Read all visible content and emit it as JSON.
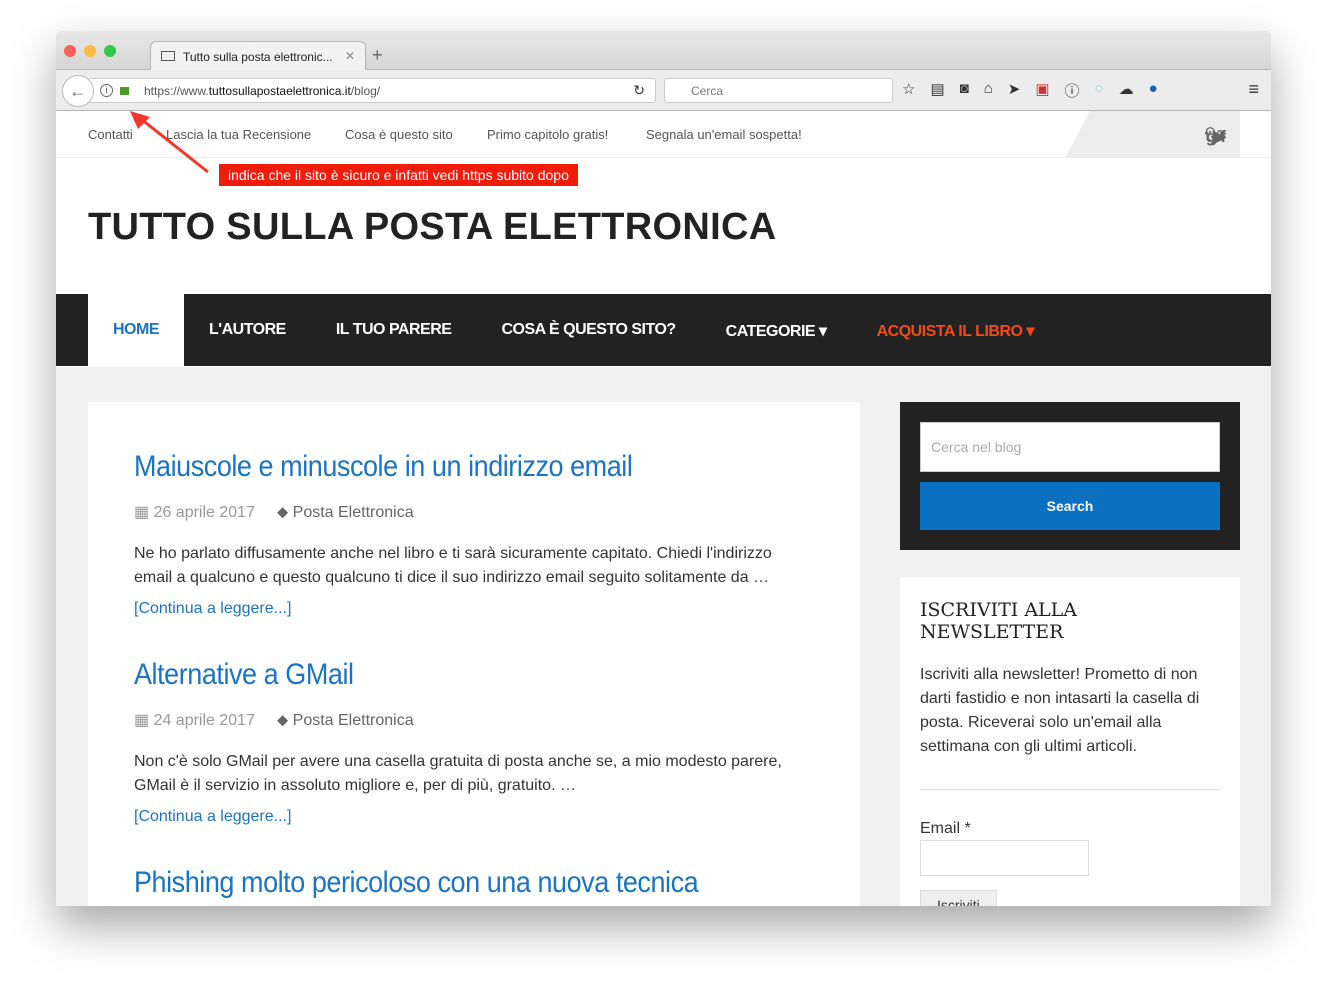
{
  "browser": {
    "tab_title": "Tutto sulla posta elettronic...",
    "url_prefix": "https://www.",
    "url_domain": "tuttosullapostaelettronica.it",
    "url_path": "/blog/",
    "search_placeholder": "Cerca"
  },
  "annotation": "indica che il sito è sicuro e infatti vedi https subito dopo",
  "topnav": [
    "Contatti",
    "Lascia la tua Recensione",
    "Cosa è questo sito",
    "Primo capitolo gratis!",
    "Segnala un'email sospetta!"
  ],
  "social": [
    "facebook",
    "twitter",
    "google-plus",
    "youtube"
  ],
  "site_title": "TUTTO SULLA POSTA ELETTRONICA",
  "mainnav": [
    {
      "label": "HOME"
    },
    {
      "label": "L'AUTORE"
    },
    {
      "label": "IL TUO PARERE"
    },
    {
      "label": "COSA È QUESTO SITO?"
    },
    {
      "label": "CATEGORIE ▾"
    },
    {
      "label": "ACQUISTA IL LIBRO ▾"
    }
  ],
  "accent": "#1a74c4",
  "highlight": "#f14b1a",
  "posts": [
    {
      "title": "Maiuscole e minuscole in un indirizzo email",
      "date": "26 aprile 2017",
      "category": "Posta Elettronica",
      "excerpt": "Ne ho parlato diffusamente anche nel libro e ti sarà sicuramente capitato. Chiedi l'indirizzo email a qualcuno e questo qualcuno ti dice il suo indirizzo email seguito solitamente da …",
      "more": "[Continua a leggere...]"
    },
    {
      "title": "Alternative a GMail",
      "date": "24 aprile 2017",
      "category": "Posta Elettronica",
      "excerpt": "Non c'è solo GMail per avere una casella gratuita di posta anche se, a mio modesto parere, GMail è il servizio in assoluto migliore e, per di più, gratuito. …",
      "more": "[Continua a leggere...]"
    },
    {
      "title": "Phishing molto pericoloso con una nuova tecnica"
    }
  ],
  "sidebar": {
    "search_placeholder": "Cerca nel blog",
    "search_button": "Search",
    "newsletter_title": "ISCRIVITI ALLA NEWSLETTER",
    "newsletter_text": "Iscriviti alla newsletter! Prometto di non darti fastidio e non intasarti la casella di posta. Riceverai solo un'email alla settimana con gli ultimi articoli.",
    "email_label": "Email *",
    "subscribe_button": "Iscriviti"
  }
}
